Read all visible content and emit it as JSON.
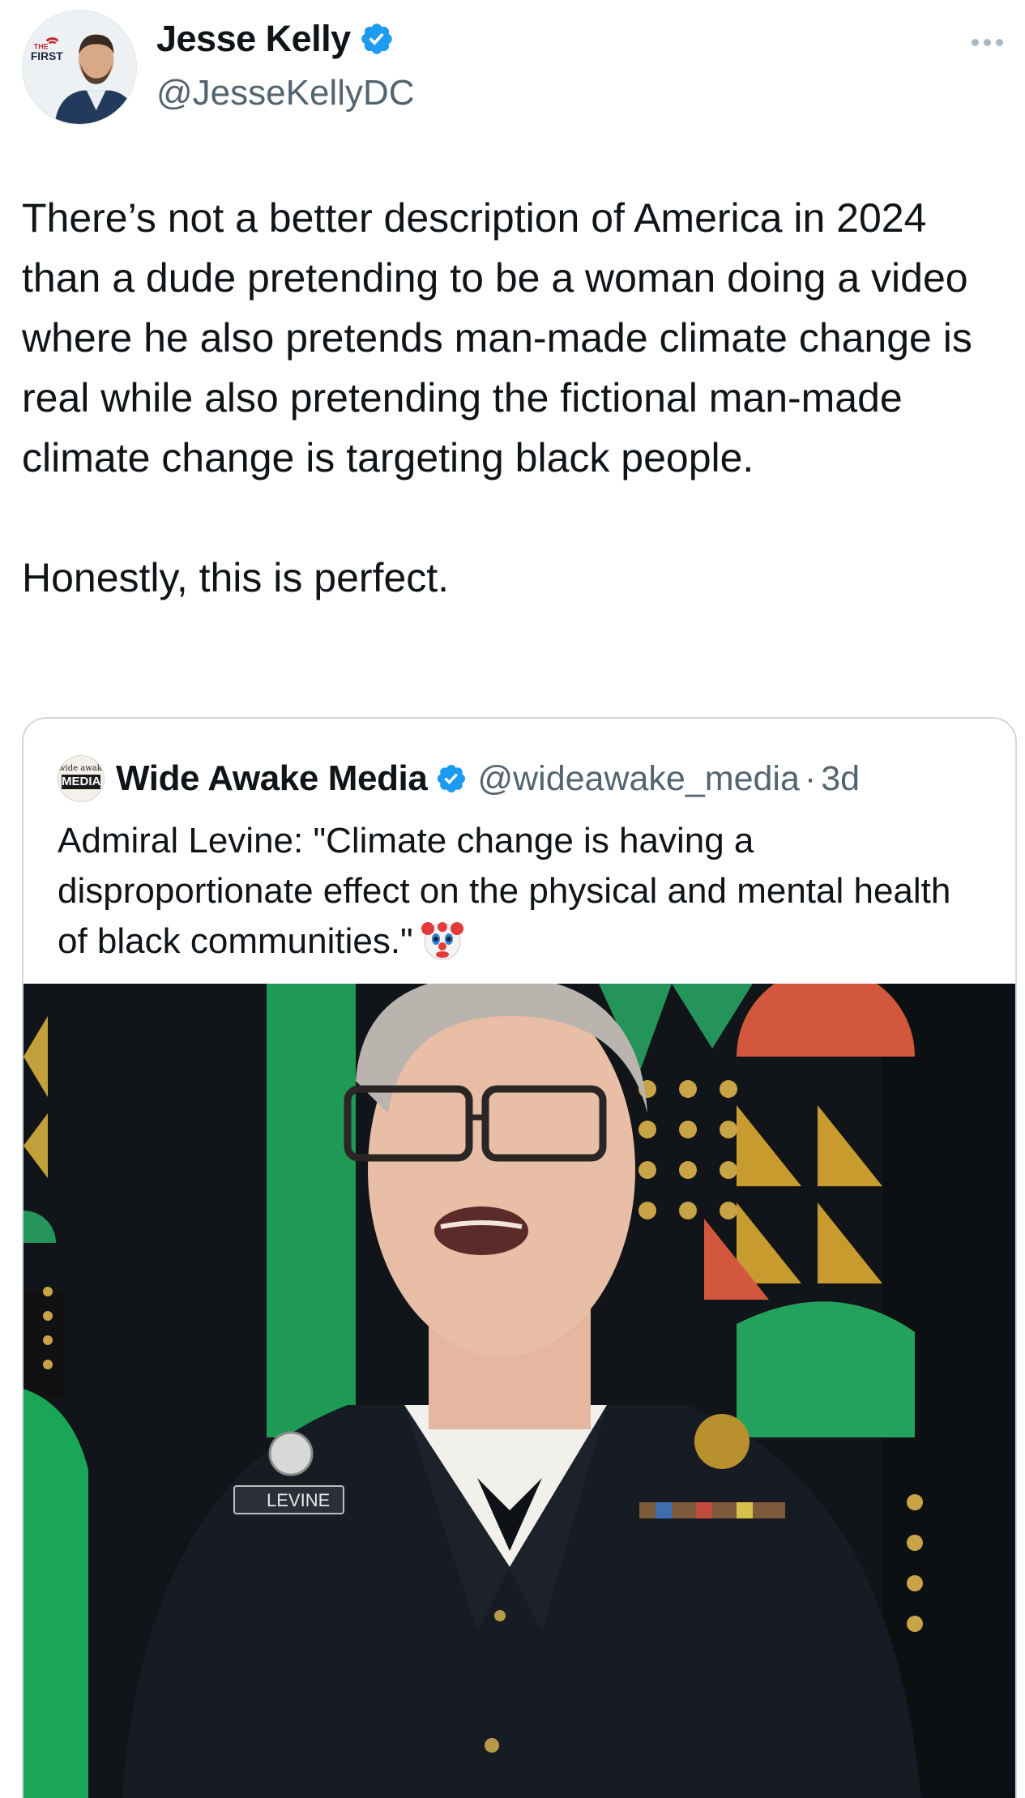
{
  "author": {
    "display_name": "Jesse Kelly",
    "handle": "@JesseKellyDC",
    "avatar_badge_top": "THE",
    "avatar_badge_main": "FIRST"
  },
  "tweet": {
    "text": "There’s not a better description of America in 2024 than a dude pretending to be a woman doing a video where he also pretends man-made climate change is real while also pretending the fictional man-made climate change is targeting black people.\n\nHonestly, this is perfect."
  },
  "quoted": {
    "display_name": "Wide Awake Media",
    "handle": "@wideawake_media",
    "separator": "·",
    "time": "3d",
    "avatar_label_top": "wide awake",
    "avatar_label_main": "MEDIA",
    "text": "Admiral Levine: \"Climate change is having a disproportionate effect on the physical and mental health of black communities.\"",
    "emoji": "clown-face",
    "video_name_tag": "LEVINE"
  },
  "colors": {
    "verified": "#1d9bf0",
    "text_primary": "#0f1419",
    "text_secondary": "#536471",
    "border": "#cfd9de"
  }
}
